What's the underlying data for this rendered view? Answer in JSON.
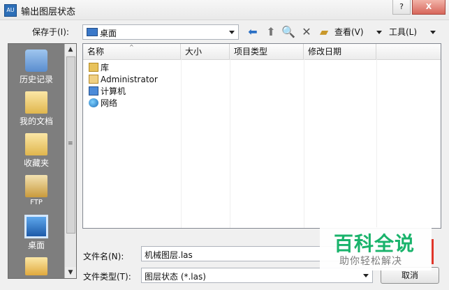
{
  "window": {
    "title": "输出图层状态",
    "app_icon_text": "AU",
    "help_button": "?",
    "close_button": "X"
  },
  "save_in": {
    "label": "保存于(I):",
    "location": "桌面"
  },
  "toolbar": {
    "view_label": "查看(V)",
    "tools_label": "工具(L)",
    "icons": [
      "back-icon",
      "up-folder-icon",
      "search-web-icon",
      "delete-icon",
      "new-folder-icon"
    ]
  },
  "places": [
    {
      "label": "历史记录",
      "icon": "history-icon"
    },
    {
      "label": "我的文档",
      "icon": "documents-icon"
    },
    {
      "label": "收藏夹",
      "icon": "favorites-icon"
    },
    {
      "label": "FTP",
      "icon": "ftp-icon"
    },
    {
      "label": "桌面",
      "icon": "desktop-icon",
      "selected": true
    },
    {
      "label": "",
      "icon": "folder-icon"
    }
  ],
  "file_list": {
    "columns": [
      "名称",
      "大小",
      "项目类型",
      "修改日期"
    ],
    "rows": [
      {
        "name": "库",
        "icon": "library-icon"
      },
      {
        "name": "Administrator",
        "icon": "user-folder-icon"
      },
      {
        "name": "计算机",
        "icon": "computer-icon"
      },
      {
        "name": "网络",
        "icon": "network-icon"
      }
    ]
  },
  "filename": {
    "label": "文件名(N):",
    "value": "机械图层.las"
  },
  "filetype": {
    "label": "文件类型(T):",
    "value": "图层状态 (*.las)"
  },
  "buttons": {
    "cancel": "取消"
  },
  "watermark": {
    "title": "百科全说",
    "subtitle": "助你轻松解决"
  }
}
